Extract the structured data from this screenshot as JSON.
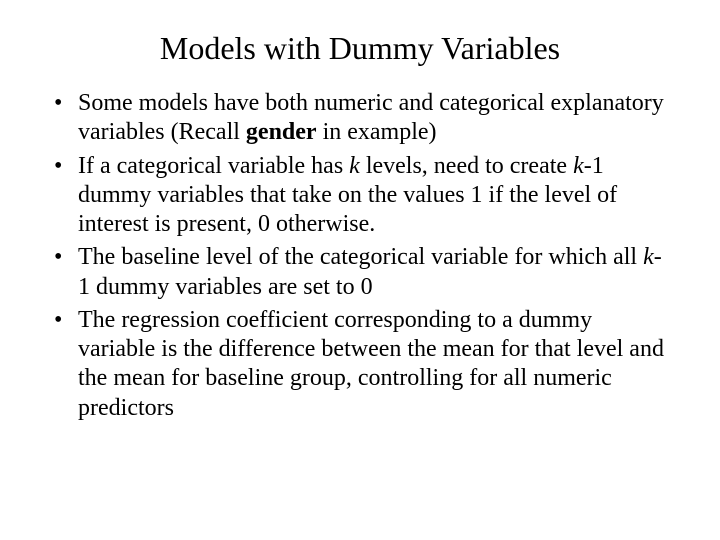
{
  "title": "Models with Dummy Variables",
  "bullets": {
    "b1": {
      "p1": "Some models have both numeric and categorical explanatory variables (Recall ",
      "p2_bold": "gender",
      "p3": " in example)"
    },
    "b2": {
      "p1": "If a categorical variable has ",
      "p2_ital": "k",
      "p3": " levels, need to create ",
      "p4_ital": "k",
      "p5": "-1 dummy variables that take on the values 1 if the level of interest is present, 0 otherwise."
    },
    "b3": {
      "p1": "The baseline level of the categorical variable for which all ",
      "p2_ital": "k",
      "p3": "-1 dummy variables are set to 0"
    },
    "b4": {
      "p1": "The regression coefficient corresponding to a dummy variable is the difference between the mean for that level and the mean for baseline group, controlling for all numeric predictors"
    }
  }
}
